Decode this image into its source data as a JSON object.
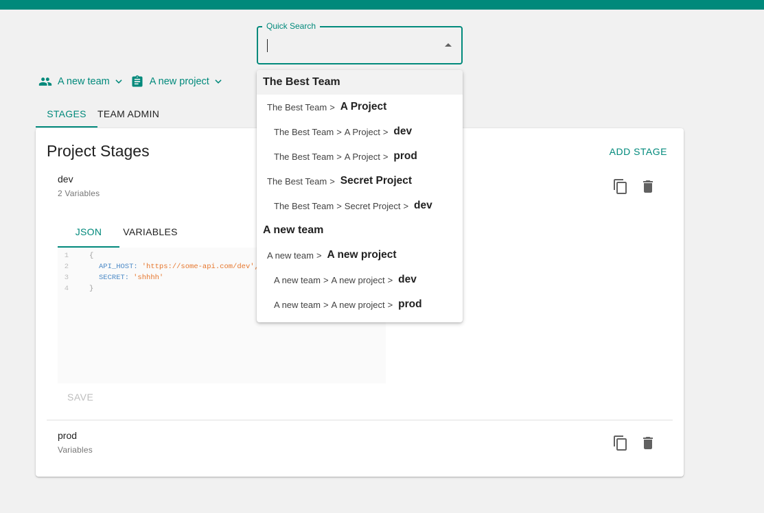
{
  "app": {
    "accent": "#00897b"
  },
  "nav": {
    "team": {
      "label": "A new team",
      "icon": "people-icon"
    },
    "project": {
      "label": "A new project",
      "icon": "clipboard-icon"
    }
  },
  "tabs": {
    "stages": "STAGES",
    "team_admin": "TEAM ADMIN"
  },
  "card": {
    "title": "Project Stages",
    "add_stage": "ADD STAGE",
    "stages": [
      {
        "name": "dev",
        "subtitle": "2 Variables",
        "tabs": {
          "json": "JSON",
          "variables": "VARIABLES"
        },
        "save": "SAVE",
        "code": {
          "line_numbers": [
            "1",
            "2",
            "3",
            "4"
          ],
          "open_brace": "{",
          "close_brace": "}",
          "key1": "API_HOST:",
          "val1": "'https://some-api.com/dev',",
          "key2": "SECRET:",
          "val2": "'shhhh'"
        }
      },
      {
        "name": "prod",
        "subtitle": "Variables"
      }
    ]
  },
  "quick_search": {
    "label": "Quick Search",
    "value": "",
    "separator": ">",
    "options": [
      {
        "type": "group",
        "label": "The Best Team",
        "highlighted": true
      },
      {
        "type": "project",
        "team": "The Best Team",
        "label": "A Project"
      },
      {
        "type": "stage",
        "team": "The Best Team",
        "project": "A Project",
        "label": "dev"
      },
      {
        "type": "stage",
        "team": "The Best Team",
        "project": "A Project",
        "label": "prod"
      },
      {
        "type": "project",
        "team": "The Best Team",
        "label": "Secret Project"
      },
      {
        "type": "stage",
        "team": "The Best Team",
        "project": "Secret Project",
        "label": "dev"
      },
      {
        "type": "group",
        "label": "A new team"
      },
      {
        "type": "project",
        "team": "A new team",
        "label": "A new project"
      },
      {
        "type": "stage",
        "team": "A new team",
        "project": "A new project",
        "label": "dev"
      },
      {
        "type": "stage",
        "team": "A new team",
        "project": "A new project",
        "label": "prod"
      }
    ]
  }
}
